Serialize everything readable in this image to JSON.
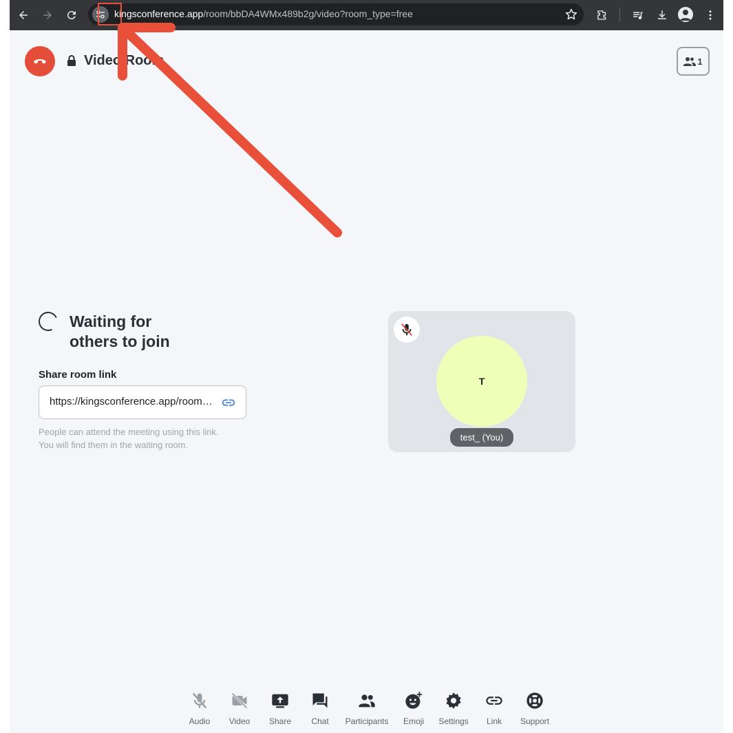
{
  "browser": {
    "url_host": "kingsconference.app",
    "url_path": "/room/bbDA4WMx489b2g/video?room_type=free"
  },
  "header": {
    "room_title": "Video Room",
    "participant_count": "1"
  },
  "waiting": {
    "line1": "Waiting for",
    "line2": "others to join"
  },
  "share": {
    "label": "Share room link",
    "link": "https://kingsconference.app/room/bbDA4WMx489b2g/video?room_type=free",
    "help_line1": "People can attend the meeting using this link.",
    "help_line2": "You will find them in the waiting room."
  },
  "tile": {
    "initial": "T",
    "name": "test_ (You)"
  },
  "controls": [
    {
      "label": "Audio",
      "icon": "mic-off-icon"
    },
    {
      "label": "Video",
      "icon": "camera-off-icon"
    },
    {
      "label": "Share",
      "icon": "screen-share-icon"
    },
    {
      "label": "Chat",
      "icon": "chat-icon"
    },
    {
      "label": "Participants",
      "icon": "people-icon"
    },
    {
      "label": "Emoji",
      "icon": "emoji-icon"
    },
    {
      "label": "Settings",
      "icon": "gear-icon"
    },
    {
      "label": "Link",
      "icon": "link-icon"
    },
    {
      "label": "Support",
      "icon": "lifebuoy-icon"
    }
  ],
  "colors": {
    "end_call": "#e54d3b",
    "annotation": "#e8503a",
    "avatar": "#eeffb8",
    "link_icon": "#3b82d6"
  }
}
